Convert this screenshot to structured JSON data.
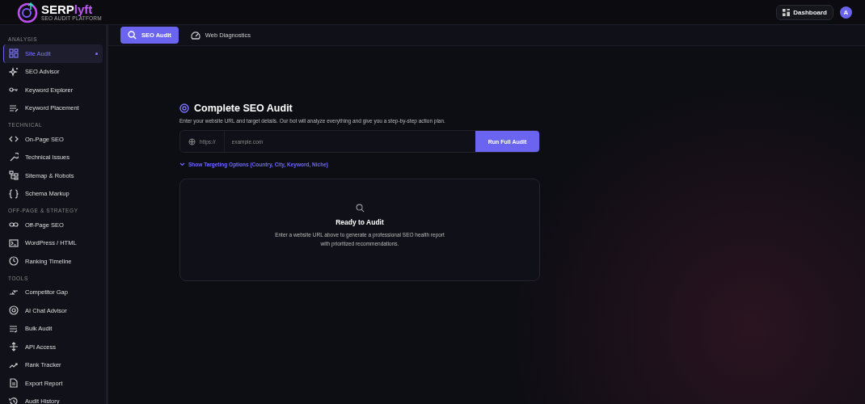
{
  "brand": {
    "primary": "SERP",
    "accent": "lyft",
    "tagline": "SEO AUDIT PLATFORM"
  },
  "header": {
    "dashboard": "Dashboard",
    "avatar": "A"
  },
  "sidebar": {
    "sections": [
      {
        "title": "ANALYSIS",
        "items": [
          {
            "label": "Site Audit",
            "selected": true
          },
          {
            "label": "SEO Advisor",
            "selected": false
          },
          {
            "label": "Keyword Explorer",
            "selected": false
          },
          {
            "label": "Keyword Placement",
            "selected": false
          }
        ]
      },
      {
        "title": "TECHNICAL",
        "items": [
          {
            "label": "On-Page SEO",
            "selected": false
          },
          {
            "label": "Technical Issues",
            "selected": false
          },
          {
            "label": "Sitemap & Robots",
            "selected": false
          },
          {
            "label": "Schema Markup",
            "selected": false
          }
        ]
      },
      {
        "title": "OFF-PAGE & STRATEGY",
        "items": [
          {
            "label": "Off-Page SEO",
            "selected": false
          },
          {
            "label": "WordPress / HTML",
            "selected": false
          },
          {
            "label": "Ranking Timeline",
            "selected": false
          }
        ]
      },
      {
        "title": "TOOLS",
        "items": [
          {
            "label": "Competitor Gap",
            "selected": false
          },
          {
            "label": "AI Chat Advisor",
            "selected": false
          },
          {
            "label": "Bulk Audit",
            "selected": false
          },
          {
            "label": "API Access",
            "selected": false
          },
          {
            "label": "Rank Tracker",
            "selected": false
          },
          {
            "label": "Export Report",
            "selected": false
          },
          {
            "label": "Audit History",
            "selected": false
          }
        ]
      }
    ]
  },
  "tabs": [
    {
      "label": "SEO Audit",
      "selected": true
    },
    {
      "label": "Web Diagnostics",
      "selected": false
    }
  ],
  "audit": {
    "title": "Complete SEO Audit",
    "description": "Enter your website URL and target details. Our bot will analyze everything and give you a step-by-step action plan.",
    "prefix": "https://",
    "placeholder": "example.com",
    "button": "Run Full Audit",
    "toggle": "Show Targeting Options (Country, City, Keyword, Niche)"
  },
  "empty_state": {
    "title": "Ready to Audit",
    "message": "Enter a website URL above to generate a professional SEO health report with prioritized recommendations."
  }
}
